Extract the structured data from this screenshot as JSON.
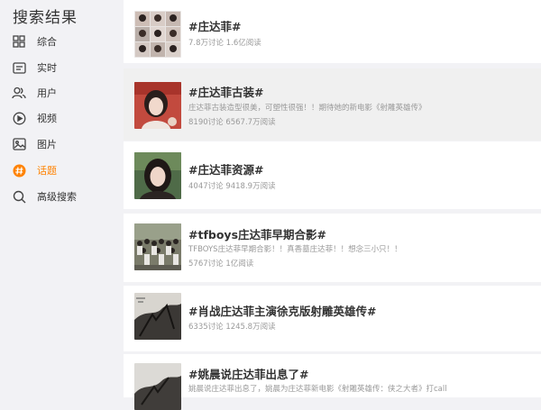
{
  "sidebar": {
    "title": "搜索结果",
    "items": [
      {
        "label": "综合",
        "icon": "grid-icon",
        "active": false
      },
      {
        "label": "实时",
        "icon": "news-icon",
        "active": false
      },
      {
        "label": "用户",
        "icon": "users-icon",
        "active": false
      },
      {
        "label": "视频",
        "icon": "play-icon",
        "active": false
      },
      {
        "label": "图片",
        "icon": "image-icon",
        "active": false
      },
      {
        "label": "话题",
        "icon": "hashtag-icon",
        "active": true
      },
      {
        "label": "高级搜索",
        "icon": "search-icon",
        "active": false
      }
    ]
  },
  "colors": {
    "accent": "#ff8200",
    "text": "#333333",
    "muted": "#999999"
  },
  "results": [
    {
      "title": "#庄达菲#",
      "desc": "",
      "stats": "7.8万讨论 1.6亿阅读"
    },
    {
      "title": "#庄达菲古装#",
      "desc": "庄达菲古装造型很美，可塑性很强！！期待她的新电影《射雕英雄传》",
      "stats": "8190讨论 6567.7万阅读"
    },
    {
      "title": "#庄达菲资源#",
      "desc": "",
      "stats": "4047讨论 9418.9万阅读"
    },
    {
      "title": "#tfboys庄达菲早期合影#",
      "desc": "TFBOYS庄达菲早期合影！！真香墓庄达菲！！想念三小只！！",
      "stats": "5767讨论 1亿阅读"
    },
    {
      "title": "#肖战庄达菲主演徐克版射雕英雄传#",
      "desc": "",
      "stats": "6335讨论 1245.8万阅读"
    },
    {
      "title": "#姚晨说庄达菲出息了#",
      "desc": "姚晨说庄达菲出息了，姚晨为庄达菲新电影《射雕英雄传：侠之大者》打call",
      "stats": ""
    }
  ]
}
